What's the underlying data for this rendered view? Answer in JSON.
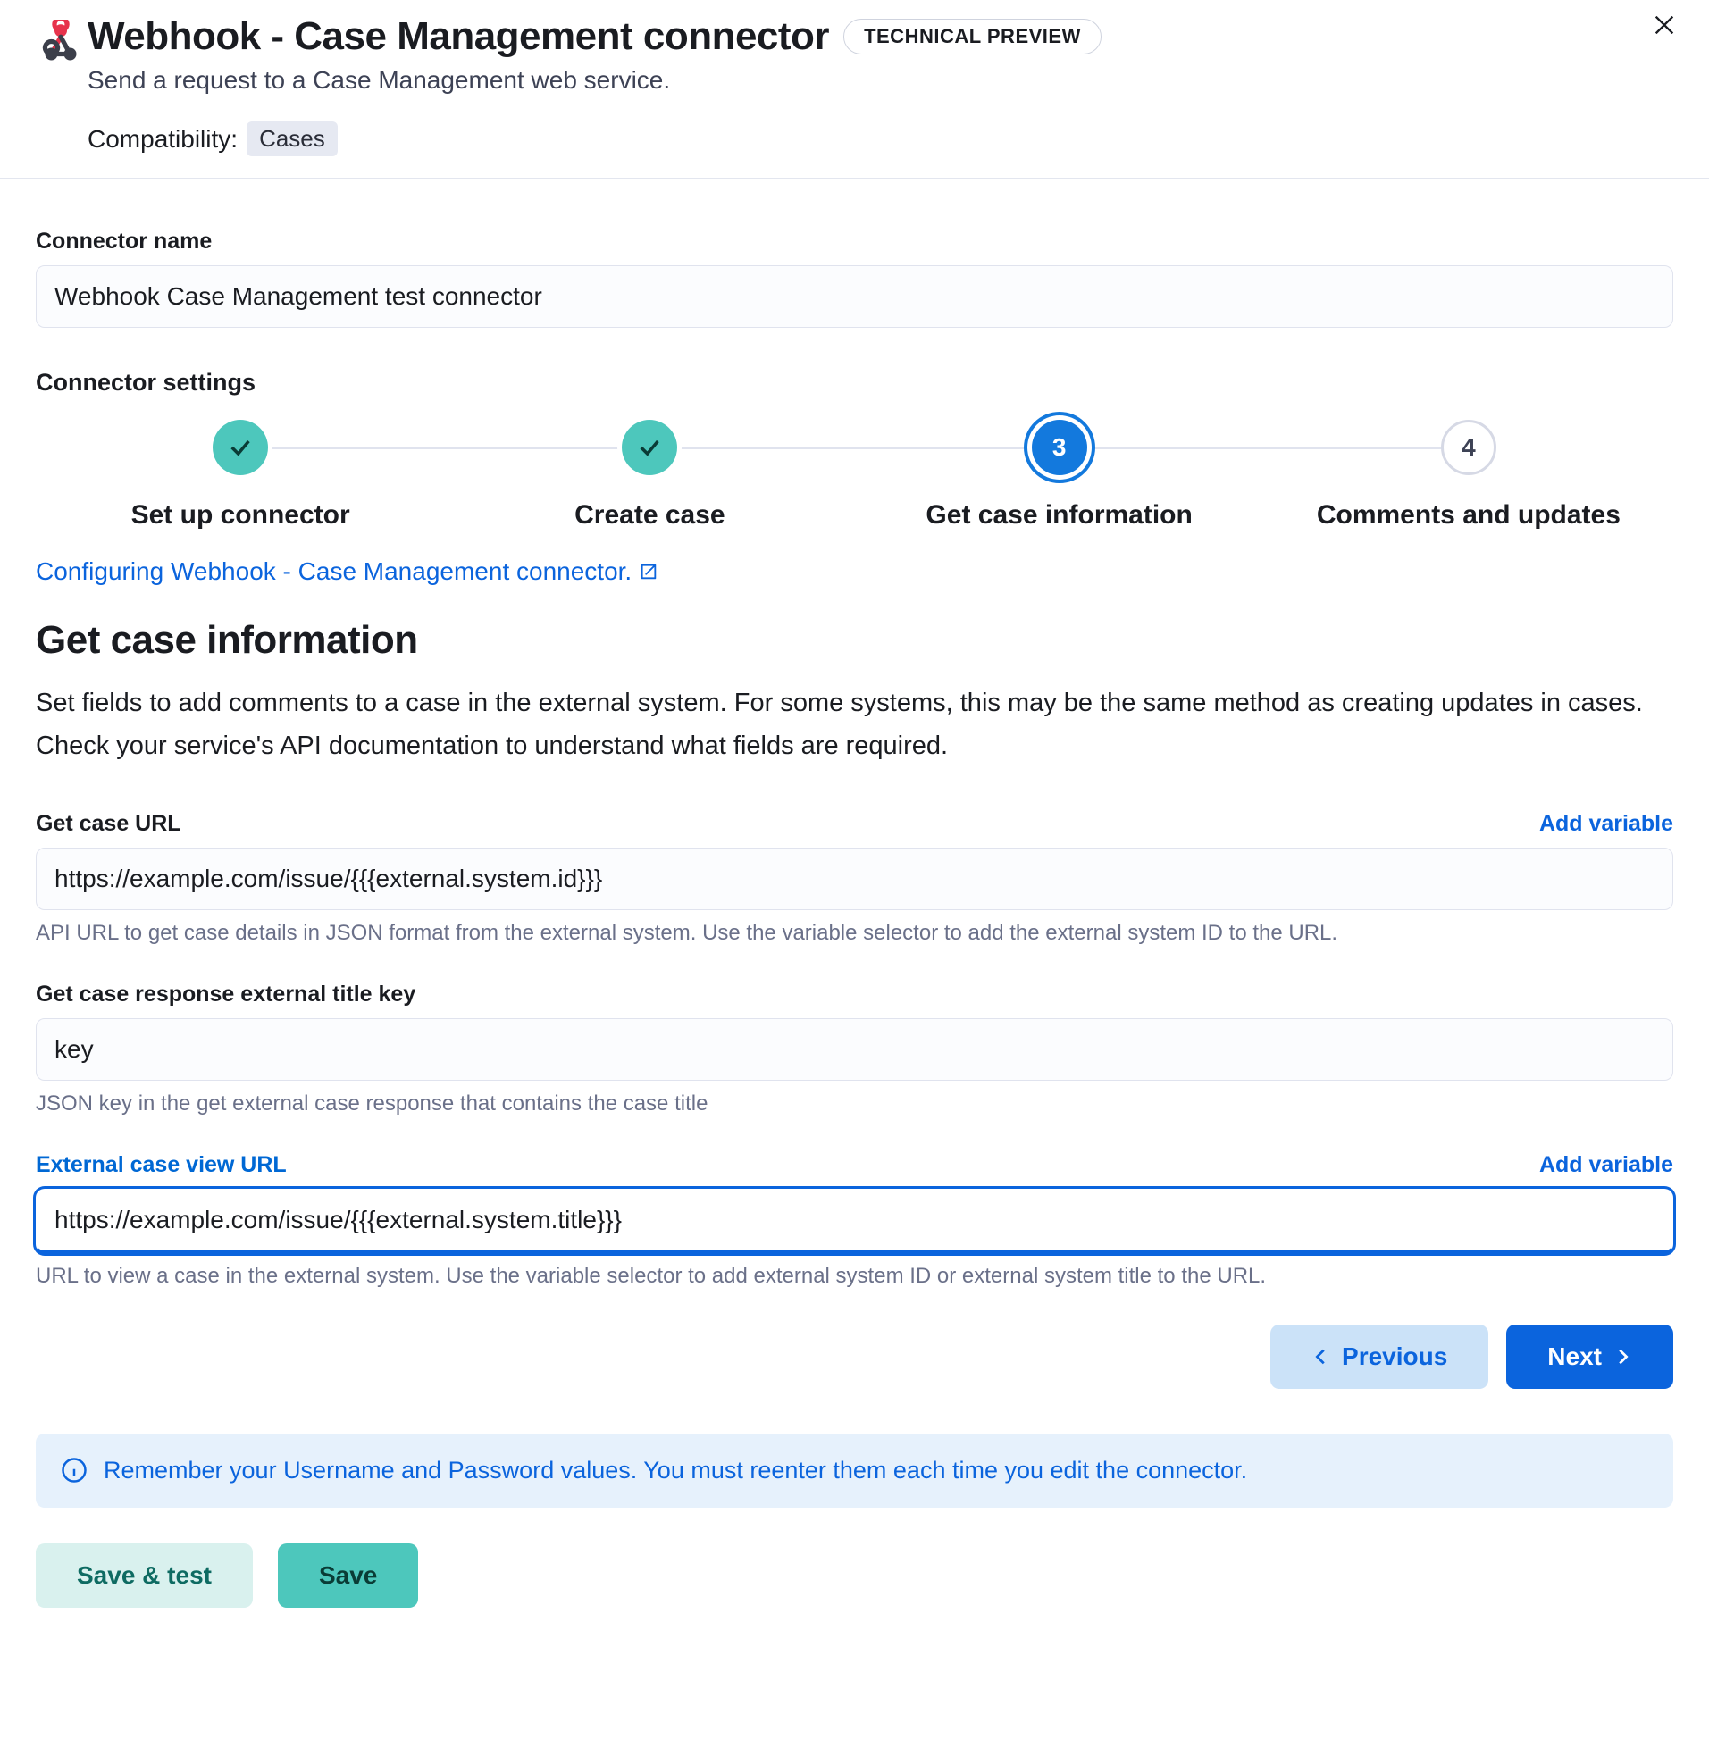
{
  "header": {
    "title": "Webhook - Case Management connector",
    "tech_badge": "TECHNICAL PREVIEW",
    "subtitle": "Send a request to a Case Management web service.",
    "compat_label": "Compatibility:",
    "compat_badge": "Cases"
  },
  "connector_name": {
    "label": "Connector name",
    "value": "Webhook Case Management test connector"
  },
  "settings_title": "Connector settings",
  "stepper": {
    "steps": [
      {
        "label": "Set up connector",
        "state": "done",
        "num": "1"
      },
      {
        "label": "Create case",
        "state": "done",
        "num": "2"
      },
      {
        "label": "Get case information",
        "state": "active",
        "num": "3"
      },
      {
        "label": "Comments and updates",
        "state": "pending",
        "num": "4"
      }
    ]
  },
  "doc_link": "Configuring Webhook - Case Management connector.",
  "page": {
    "heading": "Get case information",
    "desc": "Set fields to add comments to a case in the external system. For some systems, this may be the same method as creating updates in cases. Check your service's API documentation to understand what fields are required."
  },
  "fields": {
    "get_case_url": {
      "label": "Get case URL",
      "add_variable": "Add variable",
      "value": "https://example.com/issue/{{{external.system.id}}}",
      "help": "API URL to get case details in JSON format from the external system. Use the variable selector to add the external system ID to the URL."
    },
    "title_key": {
      "label": "Get case response external title key",
      "value": "key",
      "help": "JSON key in the get external case response that contains the case title"
    },
    "view_url": {
      "label": "External case view URL",
      "add_variable": "Add variable",
      "value": "https://example.com/issue/{{{external.system.title}}}",
      "help": "URL to view a case in the external system. Use the variable selector to add external system ID or external system title to the URL."
    }
  },
  "nav": {
    "previous": "Previous",
    "next": "Next"
  },
  "callout": "Remember your Username and Password values. You must reenter them each time you edit the connector.",
  "footer": {
    "save_test": "Save & test",
    "save": "Save"
  }
}
